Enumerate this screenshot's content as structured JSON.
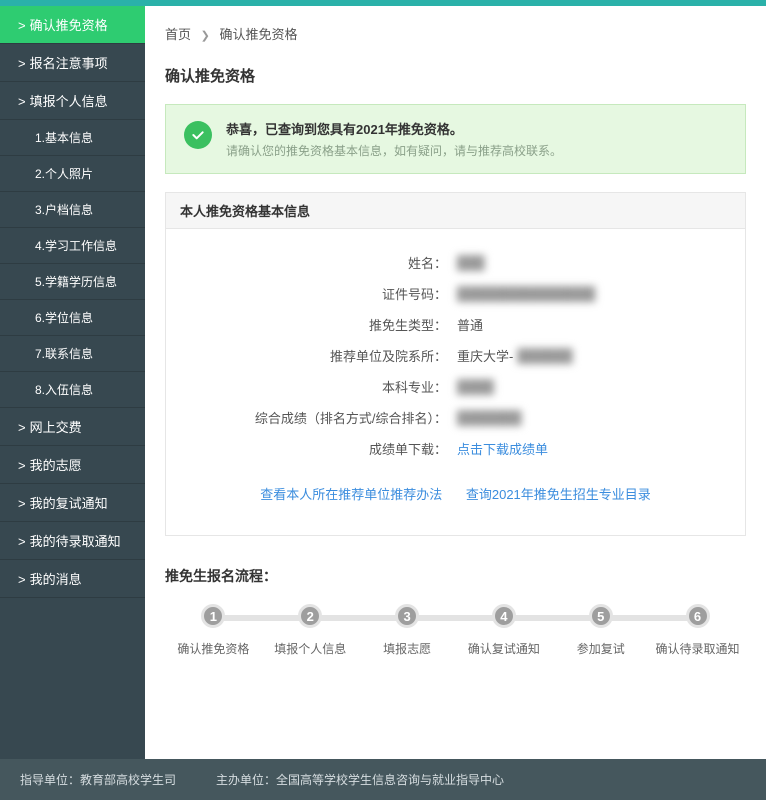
{
  "breadcrumb": {
    "home": "首页",
    "current": "确认推免资格"
  },
  "page_title": "确认推免资格",
  "alert": {
    "title": "恭喜，已查询到您具有2021年推免资格。",
    "sub": "请确认您的推免资格基本信息，如有疑问，请与推荐高校联系。"
  },
  "panel_header": "本人推免资格基本信息",
  "info": {
    "name_label": "姓名：",
    "name_value": "███",
    "id_label": "证件号码：",
    "id_value": "███████████████",
    "type_label": "推免生类型：",
    "type_value": "普通",
    "unit_label": "推荐单位及院系所：",
    "unit_prefix": "重庆大学-",
    "unit_value": "██████",
    "major_label": "本科专业：",
    "major_value": "████",
    "rank_label": "综合成绩（排名方式/综合排名）：",
    "rank_value": "███████",
    "download_label": "成绩单下载：",
    "download_link": "点击下载成绩单"
  },
  "center_links": {
    "a": "查看本人所在推荐单位推荐办法",
    "b": "查询2021年推免生招生专业目录"
  },
  "flow_title": "推免生报名流程：",
  "flow_steps": [
    {
      "n": "1",
      "label": "确认推免资格"
    },
    {
      "n": "2",
      "label": "填报个人信息"
    },
    {
      "n": "3",
      "label": "填报志愿"
    },
    {
      "n": "4",
      "label": "确认复试通知"
    },
    {
      "n": "5",
      "label": "参加复试"
    },
    {
      "n": "6",
      "label": "确认待录取通知"
    }
  ],
  "sidebar": {
    "items": [
      {
        "prefix": ">",
        "label": "确认推免资格",
        "active": true
      },
      {
        "prefix": ">",
        "label": "报名注意事项"
      },
      {
        "prefix": ">",
        "label": "填报个人信息"
      },
      {
        "label": "1.基本信息",
        "sub": true
      },
      {
        "label": "2.个人照片",
        "sub": true
      },
      {
        "label": "3.户档信息",
        "sub": true
      },
      {
        "label": "4.学习工作信息",
        "sub": true
      },
      {
        "label": "5.学籍学历信息",
        "sub": true
      },
      {
        "label": "6.学位信息",
        "sub": true
      },
      {
        "label": "7.联系信息",
        "sub": true
      },
      {
        "label": "8.入伍信息",
        "sub": true
      },
      {
        "prefix": ">",
        "label": "网上交费"
      },
      {
        "prefix": ">",
        "label": "我的志愿"
      },
      {
        "prefix": ">",
        "label": "我的复试通知"
      },
      {
        "prefix": ">",
        "label": "我的待录取通知"
      },
      {
        "prefix": ">",
        "label": "我的消息"
      }
    ]
  },
  "footer": {
    "a_label": "指导单位：",
    "a_value": "教育部高校学生司",
    "b_label": "主办单位：",
    "b_value": "全国高等学校学生信息咨询与就业指导中心"
  }
}
